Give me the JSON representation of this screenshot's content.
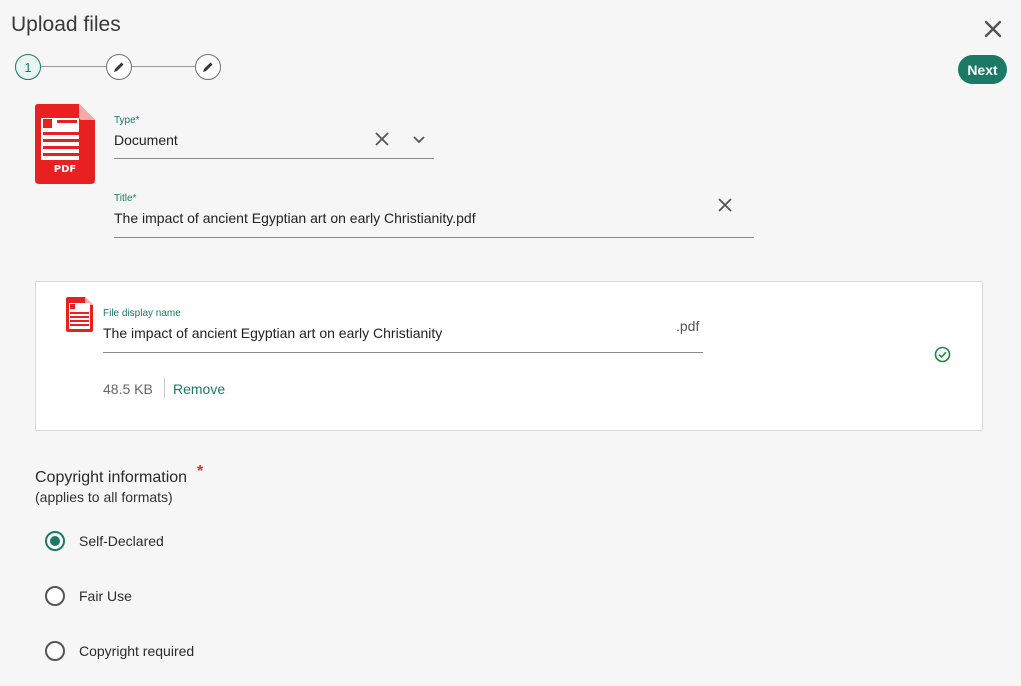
{
  "dialog": {
    "title": "Upload files",
    "next_label": "Next"
  },
  "stepper": {
    "steps": [
      {
        "label": "1",
        "state": "active"
      },
      {
        "icon": "pencil-icon",
        "state": "pending"
      },
      {
        "icon": "pencil-icon",
        "state": "pending"
      }
    ]
  },
  "file_type_icon": {
    "label": "PDF",
    "color": "#e8201f"
  },
  "form": {
    "type": {
      "label": "Type*",
      "value": "Document"
    },
    "title": {
      "label": "Title*",
      "value": "The impact of ancient Egyptian art on early Christianity.pdf"
    }
  },
  "file": {
    "display_name_label": "File display name",
    "display_name_value": "The impact of ancient Egyptian art on early Christianity",
    "extension": ".pdf",
    "size": "48.5 KB",
    "remove_label": "Remove",
    "status_icon": "check-circle-icon"
  },
  "copyright": {
    "title": "Copyright information",
    "required_mark": "*",
    "subtitle": "(applies to all formats)",
    "options": [
      {
        "label": "Self-Declared",
        "selected": true
      },
      {
        "label": "Fair Use",
        "selected": false
      },
      {
        "label": "Copyright required",
        "selected": false
      }
    ]
  },
  "colors": {
    "accent": "#1b7a66",
    "pdf_red": "#e8201f",
    "required_red": "#d62e2e"
  }
}
